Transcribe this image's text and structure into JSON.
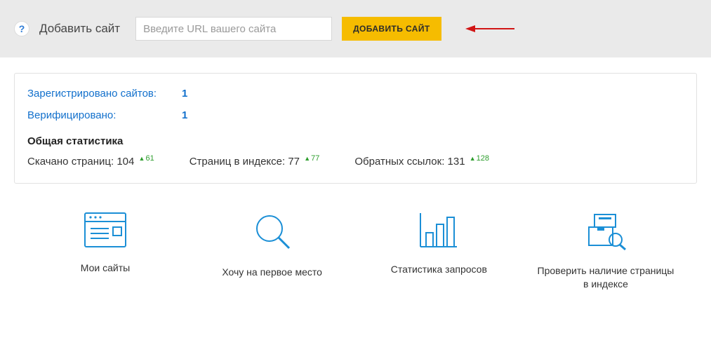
{
  "add_panel": {
    "help_glyph": "?",
    "label": "Добавить сайт",
    "placeholder": "Введите URL вашего сайта",
    "button": "ДОБАВИТЬ САЙТ"
  },
  "summary": {
    "rows": [
      {
        "label": "Зарегистрировано сайтов:",
        "value": "1"
      },
      {
        "label": "Верифицировано:",
        "value": "1"
      }
    ],
    "heading": "Общая статистика",
    "metrics": [
      {
        "label": "Скачано страниц:",
        "value": "104",
        "delta": "61"
      },
      {
        "label": "Страниц в индексе:",
        "value": "77",
        "delta": "77"
      },
      {
        "label": "Обратных ссылок:",
        "value": "131",
        "delta": "128"
      }
    ]
  },
  "tiles": [
    {
      "label": "Мои сайты"
    },
    {
      "label": "Хочу на первое место"
    },
    {
      "label": "Статистика запросов"
    },
    {
      "label": "Проверить наличие страницы в индексе"
    }
  ],
  "colors": {
    "accent_blue": "#1b8fd6",
    "link_blue": "#1270cc",
    "button_yellow": "#f6bc00",
    "arrow_red": "#d11515"
  }
}
